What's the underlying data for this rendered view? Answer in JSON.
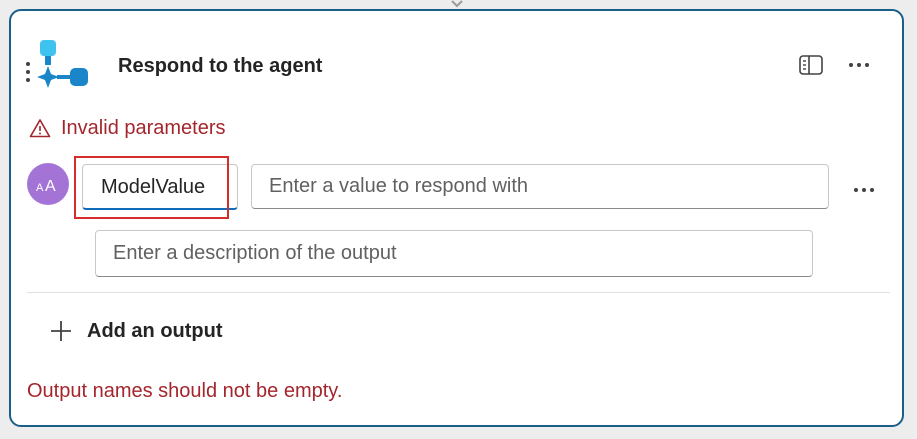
{
  "card": {
    "title": "Respond to the agent",
    "warning": "Invalid parameters",
    "avatar_text": "AA",
    "output": {
      "name_value": "ModelValue",
      "value_placeholder": "Enter a value to respond with",
      "description_placeholder": "Enter a description of the output"
    },
    "add_output_label": "Add an output",
    "error_message": "Output names should not be empty."
  },
  "colors": {
    "card_border": "#1a5f8a",
    "error_red": "#a4262c",
    "avatar_purple": "#a374d6",
    "focus_blue": "#0f6cbd",
    "highlight_red": "#d72c2c",
    "node_icon_blue": "#1a86c9",
    "node_icon_light": "#3fc3ee"
  },
  "icons": {
    "connector": "chevron-down-icon",
    "drag": "drag-handle-icon",
    "node": "agent-node-icon",
    "panel": "side-panel-icon",
    "more": "more-horizontal-icon",
    "warning": "warning-icon",
    "add": "plus-icon"
  }
}
